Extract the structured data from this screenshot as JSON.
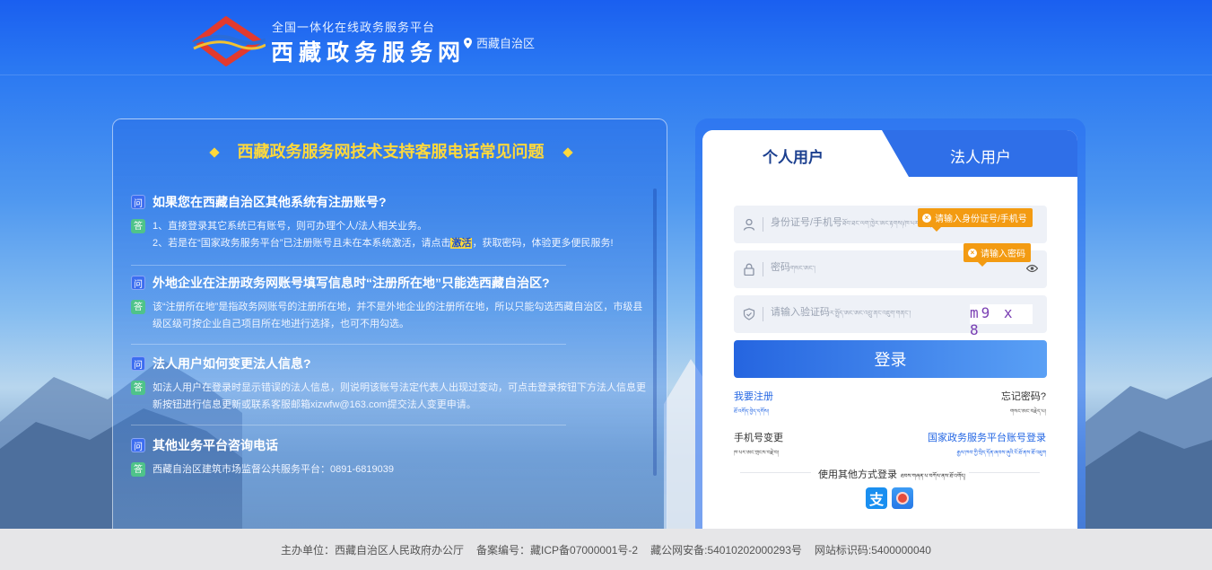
{
  "header": {
    "subtitle": "全国一体化在线政务服务平台",
    "site_name": "西藏政务服务网",
    "region": "西藏自治区"
  },
  "faq": {
    "title": "西藏政务服务网技术支持客服电话常见问题",
    "q_badge": "问",
    "a_badge": "答",
    "items": [
      {
        "question": "如果您在西藏自治区其他系统有注册账号?",
        "answer_lines": [
          "1、直接登录其它系统已有账号，则可办理个人/法人相关业务。",
          "2、若是在“国家政务服务平台”已注册账号且未在本系统激活，请点击",
          "激活",
          "，获取密码，体验更多便民服务!"
        ]
      },
      {
        "question": "外地企业在注册政务网账号填写信息时“注册所在地”只能选西藏自治区?",
        "answer": "该“注册所在地”是指政务网账号的注册所在地，并不是外地企业的注册所在地，所以只能勾选西藏自治区，市级县级区级可按企业自己项目所在地进行选择，也可不用勾选。"
      },
      {
        "question": "法人用户如何变更法人信息?",
        "answer": "如法人用户在登录时显示错误的法人信息，则说明该账号法定代表人出现过变动，可点击登录按钮下方法人信息更新按钮进行信息更新或联系客服邮箱xizwfw@163.com提交法人变更申请。"
      },
      {
        "question": "其他业务平台咨询电话",
        "answer": "西藏自治区建筑市场监督公共服务平台：0891-6819039"
      }
    ]
  },
  "login": {
    "tab_personal": "个人用户",
    "tab_legal": "法人用户",
    "id_placeholder": "身份证号/手机号",
    "id_placeholder_tib": "ཐོབ་ཐང་ལག་ཁྱེར་ཨང་རྟགས།/ཁ་པར་ཨང་།",
    "id_tip": "请输入身份证号/手机号",
    "pwd_placeholder": "密码",
    "pwd_placeholder_tib": "གསང་ཨང་།",
    "pwd_tip": "请输入密码",
    "captcha_placeholder": "请输入验证码",
    "captcha_placeholder_tib": "ར་སྤྲོད་ཨང་ཨང་འབྲུ་ནང་འཇུག་གནང་།",
    "captcha_text": "m9 x 8",
    "login_button": "登录",
    "register": "我要注册",
    "register_tib": "ཐོ་འགོད་བྱེད་དགོས།",
    "forgot": "忘记密码?",
    "forgot_tib": "གསང་ཨང་བརྗེད་པ།",
    "change_phone": "手机号变更",
    "change_phone_tib": "ཁ་པར་ཨང་གྲངས་བརྗེ་བ།",
    "national_login": "国家政务服务平台账号登录",
    "national_login_tib": "རྒྱལ་ཁབ་ཀྱི་སྲིད་དོན་ཞབས་ཞུའི་ངོ་ཐོ་ནས་ཐོ་འཇུག",
    "other_methods": "使用其他方式登录",
    "other_methods_tib": "ཐབས་གཞན་པ་བཀོལ་ནས་ཐོ་འགོད།",
    "alipay_label": "支"
  },
  "footer": {
    "host": "主办单位：西藏自治区人民政府办公厅",
    "icp": "备案编号：藏ICP备07000001号-2",
    "police": "藏公网安备:54010202000293号",
    "site_id": "网站标识码:5400000040"
  },
  "colors": {
    "primary": "#2f6fe8",
    "faq_title": "#ffd93b",
    "tip": "#f39b12",
    "answer_badge": "#4fc38a"
  }
}
